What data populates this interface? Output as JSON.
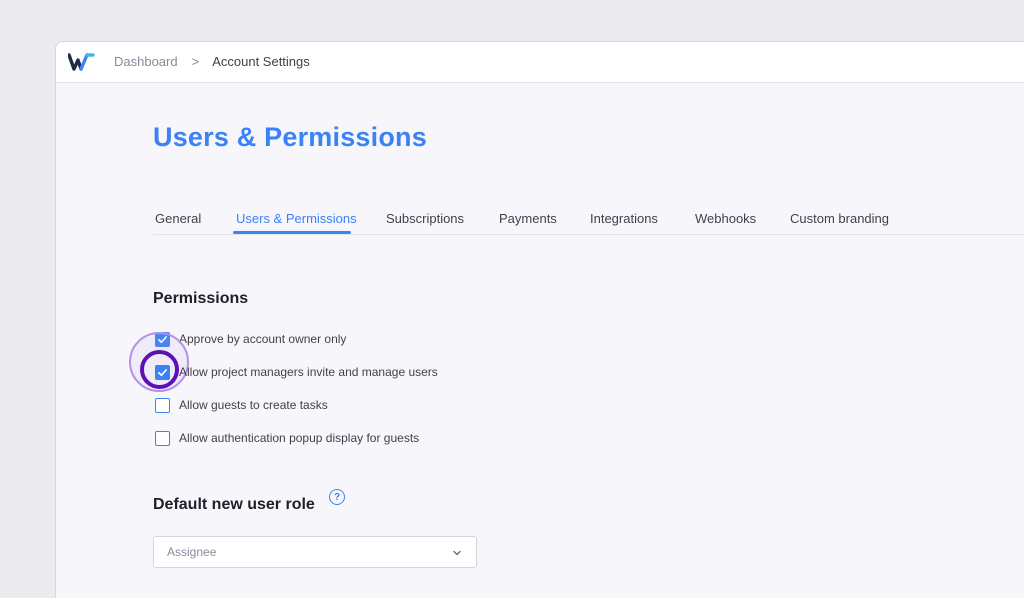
{
  "breadcrumb": {
    "parent": "Dashboard",
    "separator": ">",
    "current": "Account Settings"
  },
  "page": {
    "title": "Users & Permissions"
  },
  "tabs": [
    {
      "label": "General",
      "active": false
    },
    {
      "label": "Users & Permissions",
      "active": true
    },
    {
      "label": "Subscriptions",
      "active": false
    },
    {
      "label": "Payments",
      "active": false
    },
    {
      "label": "Integrations",
      "active": false
    },
    {
      "label": "Webhooks",
      "active": false
    },
    {
      "label": "Custom branding",
      "active": false
    }
  ],
  "permissions": {
    "title": "Permissions",
    "items": [
      {
        "label": "Approve by account owner only",
        "checked": true
      },
      {
        "label": "Allow project managers invite and manage users",
        "checked": true
      },
      {
        "label": "Allow guests to create tasks",
        "checked": false
      },
      {
        "label": "Allow authentication popup display for guests",
        "checked": false
      }
    ]
  },
  "role": {
    "title": "Default new user role",
    "help_glyph": "?",
    "selected": "Assignee"
  },
  "icons": {
    "logo": "brand-logo-icon",
    "check": "check-icon",
    "help": "question-mark-icon",
    "dropdown": "chevron-down-icon"
  },
  "colors": {
    "accent": "#3b82f6",
    "focus_ring": "#5b10b8",
    "focus_halo": "#b690e6",
    "logo_dark": "#1f2a44",
    "logo_light": "#3fb8e8"
  }
}
